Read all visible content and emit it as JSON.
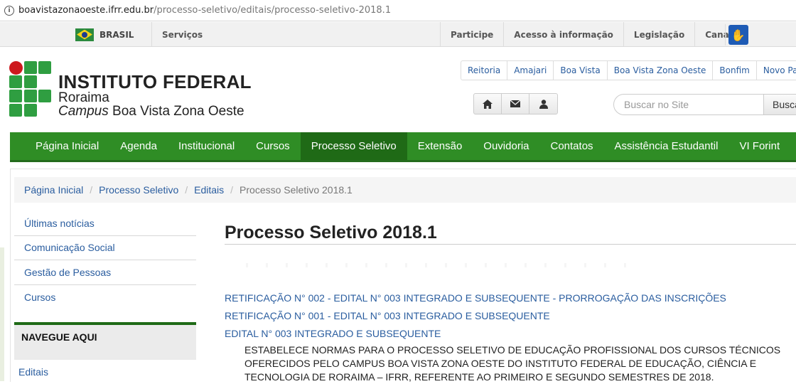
{
  "browser": {
    "url_domain": "boavistazonaoeste.ifrr.edu.br",
    "url_path": "/processo-seletivo/editais/processo-seletivo-2018.1",
    "info_icon": "info-icon"
  },
  "govbar": {
    "brasil": "BRASIL",
    "servicos": "Serviços",
    "links": [
      "Participe",
      "Acesso à informação",
      "Legislação",
      "Canais"
    ],
    "accessibility_icon": "libras-hands-icon"
  },
  "header": {
    "title": "INSTITUTO FEDERAL",
    "subtitle1": "Roraima",
    "campus_word": "Campus",
    "campus_name": " Boa Vista Zona Oeste",
    "campus_links": [
      "Reitoria",
      "Amajari",
      "Boa Vista",
      "Boa Vista Zona Oeste",
      "Bonfim",
      "Novo Paraí"
    ],
    "icons": [
      "home-icon",
      "envelope-icon",
      "user-icon"
    ],
    "search_placeholder": "Buscar no Site",
    "search_button": "Buscar"
  },
  "mainnav": {
    "items": [
      "Página Inicial",
      "Agenda",
      "Institucional",
      "Cursos",
      "Processo Seletivo",
      "Extensão",
      "Ouvidoria",
      "Contatos",
      "Assistência Estudantil",
      "VI Forint"
    ],
    "active": "Processo Seletivo"
  },
  "breadcrumb": {
    "items": [
      "Página Inicial",
      "Processo Seletivo",
      "Editais"
    ],
    "current": "Processo Seletivo 2018.1"
  },
  "sidebar": {
    "items": [
      "Últimas notícias",
      "Comunicação Social",
      "Gestão de Pessoas",
      "Cursos"
    ],
    "navegue_title": "NAVEGUE AQUI",
    "editais": "Editais"
  },
  "article": {
    "title": "Processo Seletivo 2018.1",
    "links": [
      "RETIFICAÇÃO N° 002 - EDITAL N° 003 INTEGRADO E SUBSEQUENTE - PRORROGAÇÃO DAS INSCRIÇÕES",
      "RETIFICAÇÃO N° 001 - EDITAL N° 003 INTEGRADO E SUBSEQUENTE",
      "EDITAL N° 003 INTEGRADO E SUBSEQUENTE"
    ],
    "description": "ESTABELECE NORMAS PARA O PROCESSO SELETIVO DE EDUCAÇÃO PROFISSIONAL DOS CURSOS TÉCNICOS OFERECIDOS PELO CAMPUS BOA VISTA ZONA OESTE DO INSTITUTO FEDERAL DE EDUCAÇÃO, CIÊNCIA E TECNOLOGIA DE RORAIMA – IFRR, REFERENTE AO PRIMEIRO E SEGUNDO SEMESTRES DE 2018."
  },
  "colors": {
    "nav_green": "#2f8d25",
    "nav_active": "#1f6a16",
    "link_blue": "#2a5d9f",
    "logo_red": "#cd191e",
    "logo_green": "#2f9e41"
  }
}
